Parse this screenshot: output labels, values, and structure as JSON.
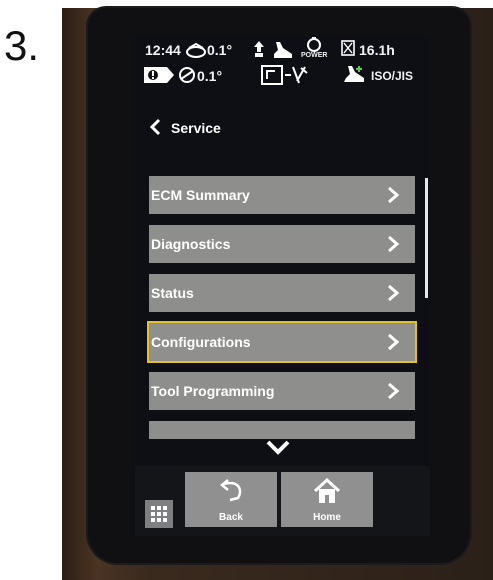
{
  "step": {
    "number": "3."
  },
  "status": {
    "time": "12:44",
    "angle1": "0.1°",
    "power_label": "POWER",
    "battery": "16.1h",
    "angle2": "0.1°",
    "pattern": "ISO/JIS"
  },
  "header": {
    "title": "Service"
  },
  "menu": {
    "items": [
      {
        "label": "ECM Summary"
      },
      {
        "label": "Diagnostics"
      },
      {
        "label": "Status"
      },
      {
        "label": "Configurations",
        "selected": true
      },
      {
        "label": "Tool Programming"
      }
    ]
  },
  "nav": {
    "back_label": "Back",
    "home_label": "Home"
  },
  "colors": {
    "menu_item_bg": "#8e8f8d",
    "selected_outline": "#e2c226",
    "screen_bg": "#0d0f14"
  },
  "icons": [
    "tilt-icon",
    "upload-icon",
    "operator-icon",
    "power-icon",
    "hourglass-icon",
    "warning-key-icon",
    "pitch-icon",
    "joystick-mode-icon",
    "pattern-icon",
    "chevron-left-icon",
    "chevron-right-icon",
    "chevron-down-icon",
    "grid-icon",
    "undo-icon",
    "home-icon"
  ]
}
